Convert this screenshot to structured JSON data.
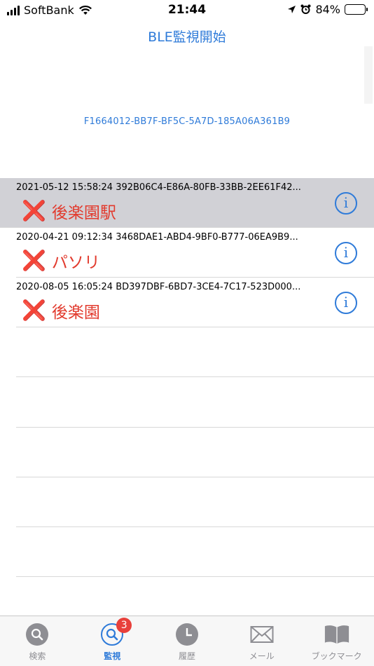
{
  "status_bar": {
    "carrier": "SoftBank",
    "time": "21:44",
    "battery": "84%",
    "battery_level": 0.84
  },
  "header": {
    "start_button": "BLE監視開始",
    "uuid": "F1664012-BB7F-BF5C-5A7D-185A06A361B9"
  },
  "rows": [
    {
      "title": "2021-05-12 15:58:24 392B06C4-E86A-80FB-33BB-2EE61F42...",
      "mark": "❌",
      "label": "後楽園駅"
    },
    {
      "title": "2020-04-21 09:12:34 3468DAE1-ABD4-9BF0-B777-06EA9B9...",
      "mark": "❌",
      "label": "パソリ"
    },
    {
      "title": "2020-08-05 16:05:24 BD397DBF-6BD7-3CE4-7C17-523D000...",
      "mark": "❌",
      "label": "後楽園"
    }
  ],
  "tabs": [
    {
      "label": "検索",
      "icon": "search-icon"
    },
    {
      "label": "監視",
      "icon": "monitor-icon",
      "badge": "3"
    },
    {
      "label": "履歴",
      "icon": "clock-icon"
    },
    {
      "label": "メール",
      "icon": "mail-icon"
    },
    {
      "label": "ブックマーク",
      "icon": "book-icon"
    }
  ],
  "colors": {
    "accent": "#2f7bd9",
    "alert": "#e23b2e",
    "selected_row": "#d1d1d6",
    "badge": "#e8403b"
  }
}
